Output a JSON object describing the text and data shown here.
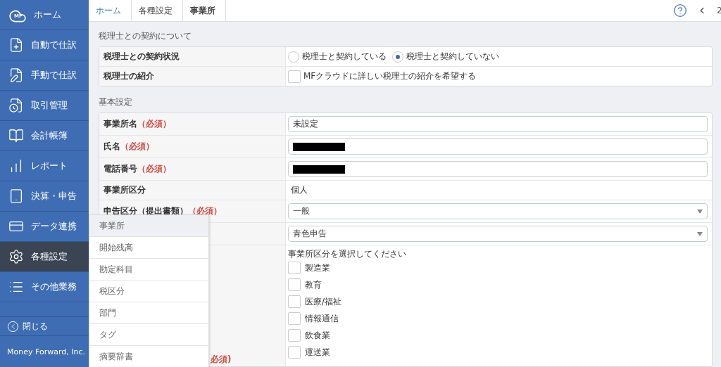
{
  "sidebar": {
    "logo_text": "MF",
    "items": [
      {
        "label": "ホーム",
        "selected": false
      },
      {
        "label": "自動で仕訳",
        "selected": false
      },
      {
        "label": "手動で仕訳",
        "selected": false
      },
      {
        "label": "取引管理",
        "selected": false
      },
      {
        "label": "会計帳簿",
        "selected": false
      },
      {
        "label": "レポート",
        "selected": false
      },
      {
        "label": "決算・申告",
        "selected": false
      },
      {
        "label": "データ連携",
        "selected": false
      },
      {
        "label": "各種設定",
        "selected": true
      },
      {
        "label": "その他業務",
        "selected": false
      }
    ],
    "close": "閉じる",
    "footer": "Money Forward, Inc."
  },
  "breadcrumb": [
    {
      "label": "ホーム",
      "link": true
    },
    {
      "label": "各種設定",
      "link": false
    },
    {
      "label": "事業所",
      "link": false
    }
  ],
  "topbar": {
    "page": "2"
  },
  "tax_section": {
    "title": "税理士との契約について",
    "rows": [
      {
        "label": "税理士との契約状況",
        "kind": "radio",
        "options": [
          {
            "label": "税理士と契約している",
            "selected": false
          },
          {
            "label": "税理士と契約していない",
            "selected": true
          }
        ]
      },
      {
        "label": "税理士の紹介",
        "kind": "checkbox",
        "text": "MFクラウドに詳しい税理士の紹介を希望する",
        "checked": false
      }
    ]
  },
  "basic_section": {
    "title": "基本設定",
    "rows": [
      {
        "label": "事業所名",
        "required": "（必須）",
        "kind": "input",
        "value": "未設定"
      },
      {
        "label": "氏名",
        "required": "（必須）",
        "kind": "input",
        "redacted": true
      },
      {
        "label": "電話番号",
        "required": "（必須）",
        "kind": "input",
        "redacted": true
      },
      {
        "label": "事業所区分",
        "kind": "text",
        "value": "個人"
      },
      {
        "label": "申告区分（提出書類）",
        "required": "（必須）",
        "kind": "select",
        "value": "一般"
      },
      {
        "kind": "select",
        "value": "青色申告"
      },
      {
        "required": "必須)",
        "kind": "industries",
        "prompt": "事業所区分を選択してください",
        "options": [
          {
            "label": "製造業",
            "checked": false
          },
          {
            "label": "教育",
            "checked": false
          },
          {
            "label": "医療/福祉",
            "checked": false
          },
          {
            "label": "情報通信",
            "checked": false
          },
          {
            "label": "飲食業",
            "checked": false
          },
          {
            "label": "運送業",
            "checked": false
          }
        ]
      }
    ]
  },
  "settings_menu": {
    "items": [
      {
        "label": "事業所",
        "selected": true
      },
      {
        "label": "開始残高",
        "selected": false
      },
      {
        "label": "勘定科目",
        "selected": false
      },
      {
        "label": "税区分",
        "selected": false
      },
      {
        "label": "部門",
        "selected": false
      },
      {
        "label": "タグ",
        "selected": false
      },
      {
        "label": "摘要辞書",
        "selected": false
      }
    ]
  }
}
